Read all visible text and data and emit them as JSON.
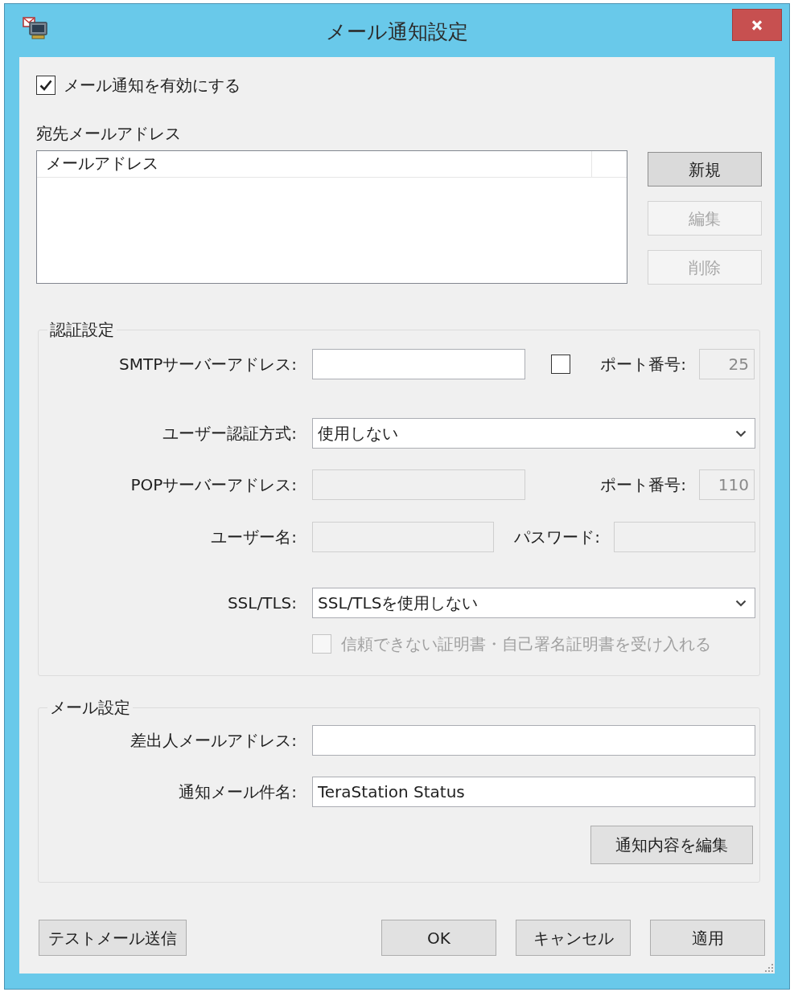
{
  "window": {
    "title": "メール通知設定"
  },
  "enable_notification": {
    "label": "メール通知を有効にする",
    "checked": true
  },
  "recipients": {
    "label": "宛先メールアドレス",
    "columns": [
      "メールアドレス"
    ],
    "buttons": [
      {
        "label": "新規",
        "disabled": false
      },
      {
        "label": "編集",
        "disabled": true
      },
      {
        "label": "削除",
        "disabled": true
      }
    ]
  },
  "auth_settings": {
    "title": "認証設定",
    "smtp_server": {
      "label": "SMTPサーバーアドレス:",
      "disabled": false
    },
    "custom_port": {
      "checked": false
    },
    "smtp_port": {
      "label": "ポート番号:",
      "value": "25",
      "disabled": true
    },
    "auth_method": {
      "label": "ユーザー認証方式:",
      "value": "使用しない"
    },
    "pop_server": {
      "label": "POPサーバーアドレス:",
      "disabled": true
    },
    "pop_port": {
      "label": "ポート番号:",
      "value": "110",
      "disabled": true
    },
    "username": {
      "label": "ユーザー名:",
      "disabled": true
    },
    "password": {
      "label": "パスワード:",
      "disabled": true
    },
    "ssl_tls": {
      "label": "SSL/TLS:",
      "value": "SSL/TLSを使用しない"
    },
    "accept_untrusted_certificates": {
      "label": "信頼できない証明書・自己署名証明書を受け入れる",
      "checked": false,
      "disabled": true
    }
  },
  "mail_settings": {
    "title": "メール設定",
    "sender_address": {
      "label": "差出人メールアドレス:",
      "disabled": false
    },
    "subject": {
      "label": "通知メール件名:",
      "value": "TeraStation Status",
      "disabled": false
    },
    "edit_content_button": {
      "label": "通知内容を編集"
    }
  },
  "footer": {
    "test_button": {
      "label": "テストメール送信"
    },
    "buttons": [
      {
        "label": "OK"
      },
      {
        "label": "キャンセル"
      },
      {
        "label": "適用"
      }
    ]
  }
}
